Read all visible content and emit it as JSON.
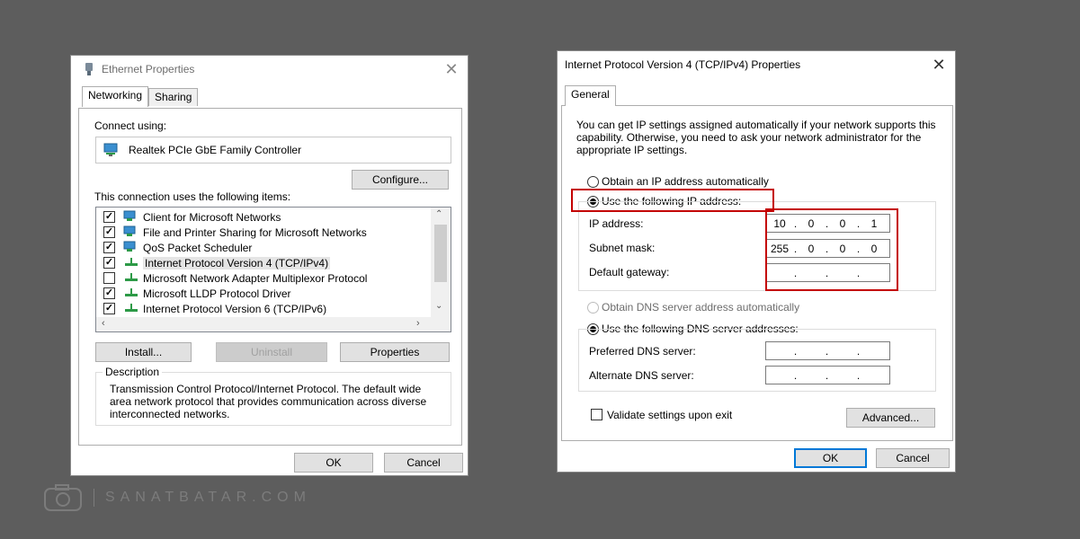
{
  "left": {
    "title": "Ethernet Properties",
    "tabs": [
      "Networking",
      "Sharing"
    ],
    "connect_using_label": "Connect using:",
    "adapter": "Realtek PCIe GbE Family Controller",
    "configure": "Configure...",
    "items_label": "This connection uses the following items:",
    "items": [
      {
        "label": "Client for Microsoft Networks",
        "checked": true,
        "icon": "network-client-icon"
      },
      {
        "label": "File and Printer Sharing for Microsoft Networks",
        "checked": true,
        "icon": "network-client-icon"
      },
      {
        "label": "QoS Packet Scheduler",
        "checked": true,
        "icon": "network-client-icon"
      },
      {
        "label": "Internet Protocol Version 4 (TCP/IPv4)",
        "checked": true,
        "icon": "protocol-icon"
      },
      {
        "label": "Microsoft Network Adapter Multiplexor Protocol",
        "checked": false,
        "icon": "protocol-icon"
      },
      {
        "label": "Microsoft LLDP Protocol Driver",
        "checked": true,
        "icon": "protocol-icon"
      },
      {
        "label": "Internet Protocol Version 6 (TCP/IPv6)",
        "checked": true,
        "icon": "protocol-icon"
      }
    ],
    "install": "Install...",
    "uninstall": "Uninstall",
    "properties": "Properties",
    "description_label": "Description",
    "description": "Transmission Control Protocol/Internet Protocol. The default wide area network protocol that provides communication across diverse interconnected networks.",
    "ok": "OK",
    "cancel": "Cancel"
  },
  "right": {
    "title": "Internet Protocol Version 4 (TCP/IPv4) Properties",
    "tab": "General",
    "intro": "You can get IP settings assigned automatically if your network supports this capability. Otherwise, you need to ask your network administrator for the appropriate IP settings.",
    "obtain_ip": "Obtain an IP address automatically",
    "use_ip": "Use the following IP address:",
    "ip_label": "IP address:",
    "ip": [
      "10",
      "0",
      "0",
      "1"
    ],
    "subnet_label": "Subnet mask:",
    "subnet": [
      "255",
      "0",
      "0",
      "0"
    ],
    "gateway_label": "Default gateway:",
    "obtain_dns": "Obtain DNS server address automatically",
    "use_dns": "Use the following DNS server addresses:",
    "pref_dns_label": "Preferred DNS server:",
    "alt_dns_label": "Alternate DNS server:",
    "validate": "Validate settings upon exit",
    "advanced": "Advanced...",
    "ok": "OK",
    "cancel": "Cancel"
  },
  "watermark": "SANATBATAR.COM"
}
